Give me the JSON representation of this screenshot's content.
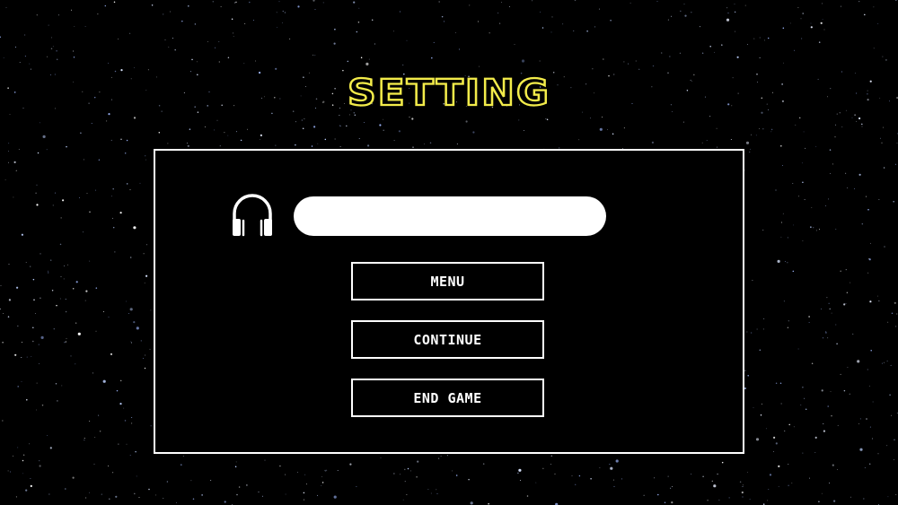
{
  "title": "SETTING",
  "colors": {
    "title_outline": "#f3ec4a",
    "panel_border": "#ffffff",
    "background": "#000000"
  },
  "volume": {
    "icon": "headphones-icon",
    "level": 1.0
  },
  "buttons": {
    "menu": "MENU",
    "continue": "CONTINUE",
    "end_game": "END GAME"
  }
}
